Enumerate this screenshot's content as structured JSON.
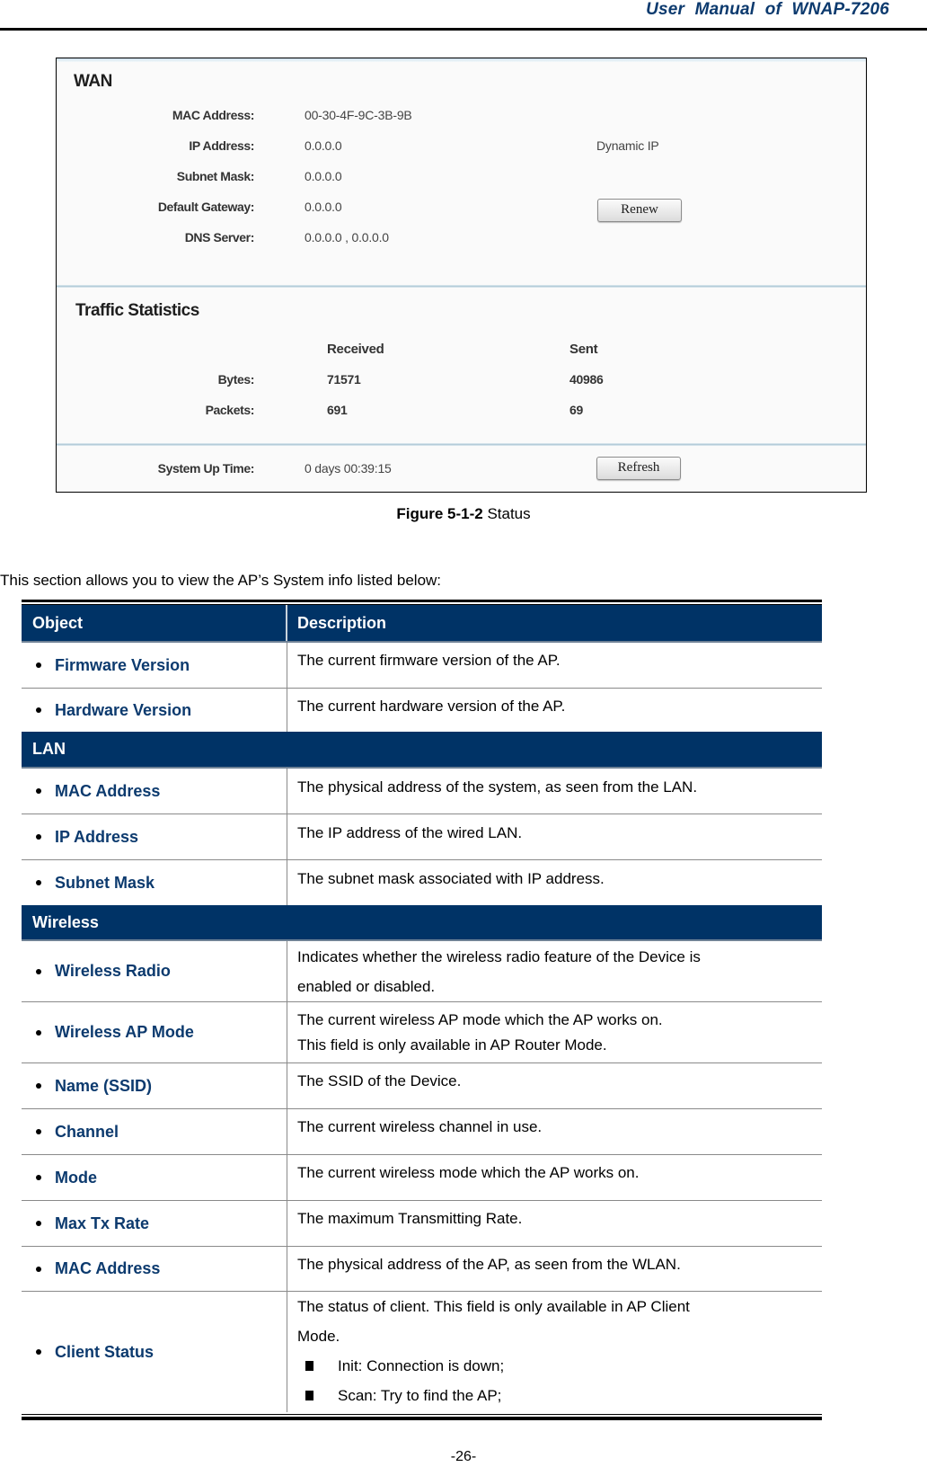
{
  "header": {
    "running_title": "User  Manual  of  WNAP-7206"
  },
  "figure": {
    "wan": {
      "title": "WAN",
      "fields": [
        {
          "label": "MAC Address:",
          "value": "00-30-4F-9C-3B-9B"
        },
        {
          "label": "IP Address:",
          "value": "0.0.0.0",
          "extra": "Dynamic IP"
        },
        {
          "label": "Subnet Mask:",
          "value": "0.0.0.0"
        },
        {
          "label": "Default Gateway:",
          "value": "0.0.0.0"
        },
        {
          "label": "DNS Server:",
          "value": "0.0.0.0 , 0.0.0.0"
        }
      ],
      "renew_button": "Renew"
    },
    "traffic": {
      "title": "Traffic Statistics",
      "col_received": "Received",
      "col_sent": "Sent",
      "rows": [
        {
          "label": "Bytes:",
          "received": "71571",
          "sent": "40986"
        },
        {
          "label": "Packets:",
          "received": "691",
          "sent": "69"
        }
      ]
    },
    "uptime": {
      "label": "System Up Time:",
      "value": "0 days 00:39:15",
      "refresh_button": "Refresh"
    }
  },
  "caption": {
    "number": "Figure 5-1-2",
    "text": " Status"
  },
  "intro": "This section allows you to view the AP’s System info listed below:",
  "table": {
    "col_object": "Object",
    "col_description": "Description",
    "rows1": [
      {
        "object": "Firmware Version",
        "desc": [
          "The current firmware version of the AP."
        ]
      },
      {
        "object": "Hardware Version",
        "desc": [
          "The current hardware version of the AP."
        ]
      }
    ],
    "group_lan": "LAN",
    "rows_lan": [
      {
        "object": "MAC Address",
        "desc": [
          "The physical address of the system, as seen from the LAN."
        ]
      },
      {
        "object": "IP Address",
        "desc": [
          "The IP address of the wired LAN."
        ]
      },
      {
        "object": "Subnet Mask",
        "desc": [
          "The subnet mask associated with IP address."
        ]
      }
    ],
    "group_wireless": "Wireless",
    "rows_wireless": [
      {
        "object": "Wireless Radio",
        "desc": [
          "Indicates whether the wireless radio feature of the Device is",
          "enabled or disabled."
        ]
      },
      {
        "object": "Wireless AP Mode",
        "desc": [
          "The current wireless AP mode which the AP works on.",
          "This field is only available in AP Router Mode."
        ]
      },
      {
        "object": "Name (SSID)",
        "desc": [
          "The SSID of the Device."
        ]
      },
      {
        "object": "Channel",
        "desc": [
          "The current wireless channel in use."
        ]
      },
      {
        "object": "Mode",
        "desc": [
          "The current wireless mode which the AP works on."
        ]
      },
      {
        "object": "Max Tx Rate",
        "desc": [
          "The maximum Transmitting Rate."
        ]
      },
      {
        "object": "MAC Address",
        "desc": [
          "The physical address of the AP, as seen from the WLAN."
        ]
      }
    ],
    "client_status": {
      "object": "Client Status",
      "desc": [
        "The status of client. This field is only available in AP Client",
        "Mode."
      ],
      "bullets": [
        "Init: Connection is down;",
        "Scan: Try to find the AP;"
      ]
    }
  },
  "page_number": "-26-"
}
